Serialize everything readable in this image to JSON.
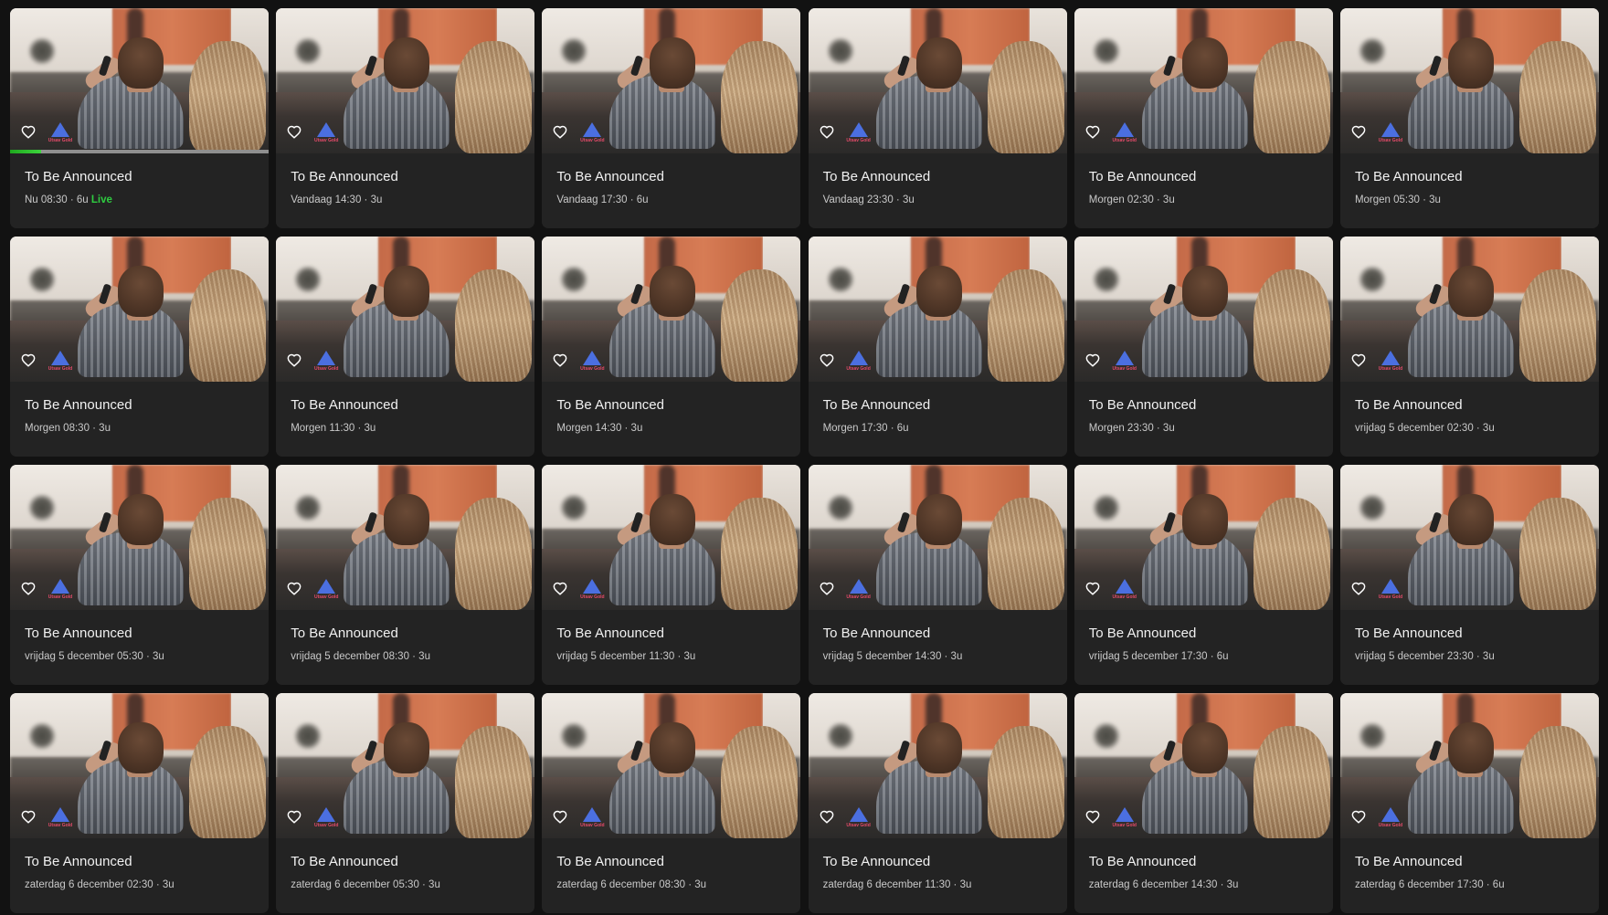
{
  "colors": {
    "background": "#121212",
    "card": "#232323",
    "live": "#2ecc40",
    "progress_track": "#8f8f8f",
    "progress_fill": "#2ecc40",
    "logo_triangle": "#4b6fe0",
    "logo_text": "#e64b6a"
  },
  "icons": {
    "favorite": "heart-outline-icon"
  },
  "channel": {
    "logo_text": "Utsav Gold"
  },
  "programs": [
    {
      "title": "To Be Announced",
      "meta": "Nu 08:30 · 6u",
      "live": "Live",
      "progress": 0.12
    },
    {
      "title": "To Be Announced",
      "meta": "Vandaag 14:30 · 3u"
    },
    {
      "title": "To Be Announced",
      "meta": "Vandaag 17:30 · 6u"
    },
    {
      "title": "To Be Announced",
      "meta": "Vandaag 23:30 · 3u"
    },
    {
      "title": "To Be Announced",
      "meta": "Morgen 02:30 · 3u"
    },
    {
      "title": "To Be Announced",
      "meta": "Morgen 05:30 · 3u"
    },
    {
      "title": "To Be Announced",
      "meta": "Morgen 08:30 · 3u"
    },
    {
      "title": "To Be Announced",
      "meta": "Morgen 11:30 · 3u"
    },
    {
      "title": "To Be Announced",
      "meta": "Morgen 14:30 · 3u"
    },
    {
      "title": "To Be Announced",
      "meta": "Morgen 17:30 · 6u"
    },
    {
      "title": "To Be Announced",
      "meta": "Morgen 23:30 · 3u"
    },
    {
      "title": "To Be Announced",
      "meta": "vrijdag 5 december 02:30 · 3u"
    },
    {
      "title": "To Be Announced",
      "meta": "vrijdag 5 december 05:30 · 3u"
    },
    {
      "title": "To Be Announced",
      "meta": "vrijdag 5 december 08:30 · 3u"
    },
    {
      "title": "To Be Announced",
      "meta": "vrijdag 5 december 11:30 · 3u"
    },
    {
      "title": "To Be Announced",
      "meta": "vrijdag 5 december 14:30 · 3u"
    },
    {
      "title": "To Be Announced",
      "meta": "vrijdag 5 december 17:30 · 6u"
    },
    {
      "title": "To Be Announced",
      "meta": "vrijdag 5 december 23:30 · 3u"
    },
    {
      "title": "To Be Announced",
      "meta": "zaterdag 6 december 02:30 · 3u"
    },
    {
      "title": "To Be Announced",
      "meta": "zaterdag 6 december 05:30 · 3u"
    },
    {
      "title": "To Be Announced",
      "meta": "zaterdag 6 december 08:30 · 3u"
    },
    {
      "title": "To Be Announced",
      "meta": "zaterdag 6 december 11:30 · 3u"
    },
    {
      "title": "To Be Announced",
      "meta": "zaterdag 6 december 14:30 · 3u"
    },
    {
      "title": "To Be Announced",
      "meta": "zaterdag 6 december 17:30 · 6u"
    }
  ]
}
